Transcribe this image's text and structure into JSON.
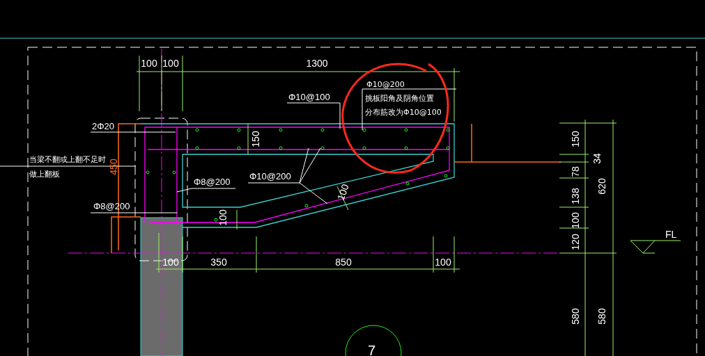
{
  "top_dimensions": [
    "100",
    "100",
    "1300"
  ],
  "bottom_dimensions": [
    "100",
    "350",
    "850",
    "100"
  ],
  "right_dimensions_inner": [
    "150",
    "34",
    "78",
    "138",
    "100",
    "120",
    "580"
  ],
  "right_dimensions_outer": [
    "620",
    "580"
  ],
  "section_dimensions": [
    {
      "text": "150",
      "kind": "dimension"
    },
    {
      "text": "450",
      "kind": "height"
    },
    {
      "text": "100",
      "kind": "dimension"
    },
    {
      "text": "100",
      "kind": "dimension"
    }
  ],
  "rebar_labels": [
    "2Φ20",
    "Φ10@100",
    "Φ10@200",
    "Φ8@200",
    "Φ8@200"
  ],
  "notes": [
    {
      "lines": [
        "当梁不翻或上翻不足时",
        "做上翻板"
      ]
    },
    {
      "lines": [
        "Φ10@200",
        "挑板阳角及阴角位置",
        "分布筋改为Φ10@100"
      ]
    }
  ],
  "level_marker": {
    "label": "FL"
  },
  "detail_marker": {
    "label": "7"
  }
}
